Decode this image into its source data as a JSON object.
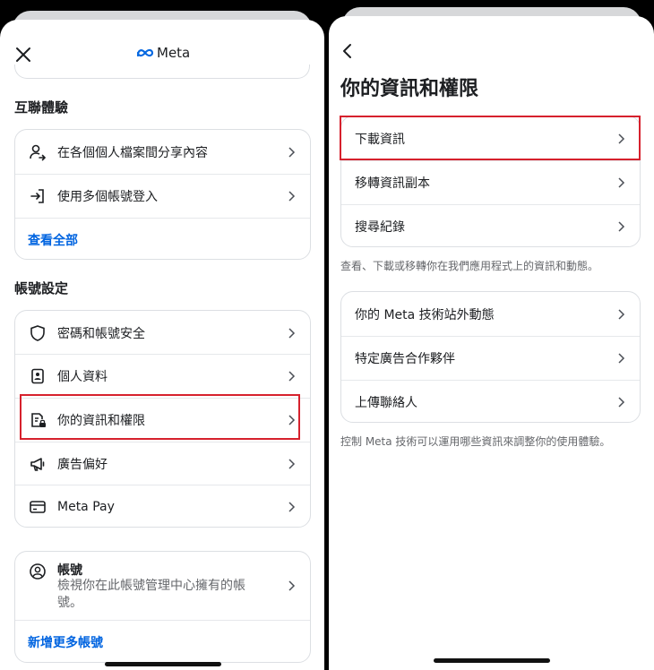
{
  "left": {
    "logo_text": "Meta",
    "section_connected": "互聯體驗",
    "connected_items": [
      {
        "label": "在各個個人檔案間分享內容",
        "icon": "person-share-icon"
      },
      {
        "label": "使用多個帳號登入",
        "icon": "login-arrow-icon"
      }
    ],
    "see_all": "查看全部",
    "section_account": "帳號設定",
    "account_items": [
      {
        "label": "密碼和帳號安全",
        "icon": "shield-icon"
      },
      {
        "label": "個人資料",
        "icon": "id-card-icon"
      },
      {
        "label": "你的資訊和權限",
        "icon": "document-lock-icon"
      },
      {
        "label": "廣告偏好",
        "icon": "megaphone-icon"
      },
      {
        "label": "Meta Pay",
        "icon": "card-icon"
      }
    ],
    "accounts_title": "帳號",
    "accounts_desc": "檢視你在此帳號管理中心擁有的帳號。",
    "add_accounts": "新增更多帳號"
  },
  "right": {
    "title": "你的資訊和權限",
    "group1": [
      "下載資訊",
      "移轉資訊副本",
      "搜尋紀錄"
    ],
    "group1_note": "查看、下載或移轉你在我們應用程式上的資訊和動態。",
    "group2": [
      "你的 Meta 技術站外動態",
      "特定廣告合作夥伴",
      "上傳聯絡人"
    ],
    "group2_note": "控制 Meta 技術可以運用哪些資訊來調整你的使用體驗。"
  },
  "colors": {
    "highlight": "#d6212d",
    "link": "#0064e0",
    "meta_blue": "#0668e1"
  }
}
